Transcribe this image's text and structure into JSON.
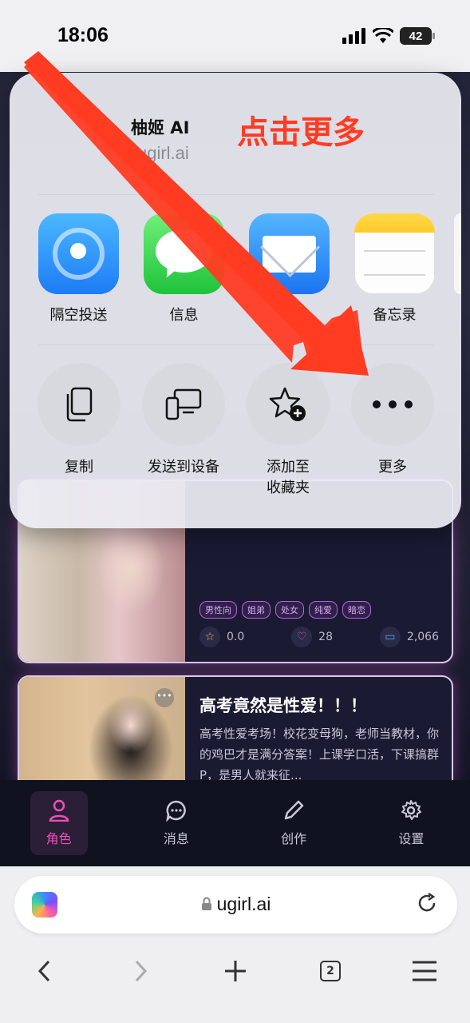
{
  "status_bar": {
    "time": "18:06",
    "battery": "42"
  },
  "share_sheet": {
    "title": "柚姬 AI",
    "url": "ugirl.ai",
    "annotation": "点击更多",
    "apps": [
      {
        "label": "隔空投送",
        "icon": "airdrop-icon"
      },
      {
        "label": "信息",
        "icon": "messages-icon"
      },
      {
        "label": "",
        "icon": "mail-icon"
      },
      {
        "label": "备忘录",
        "icon": "notes-icon"
      }
    ],
    "actions": [
      {
        "label": "复制",
        "icon": "copy-icon"
      },
      {
        "label": "发送到设备",
        "icon": "send-to-device-icon"
      },
      {
        "label": "添加至\n收藏夹",
        "icon": "add-favorite-icon"
      },
      {
        "label": "更多",
        "icon": "more-icon"
      }
    ]
  },
  "cards": [
    {
      "tags": [
        "男性向",
        "姐弟",
        "处女",
        "纯爱",
        "暗恋"
      ],
      "rating": "0.0",
      "likes": "28",
      "comments": "2,066"
    },
    {
      "title": "高考竟然是性爱！！！",
      "description": "高考性爱考场！校花变母狗，老师当教材，你的鸡巴才是满分答案！上课学口活，下课搞群P，是男人就来征..."
    }
  ],
  "tab_bar": {
    "items": [
      {
        "label": "角色",
        "icon": "person-icon",
        "active": true
      },
      {
        "label": "消息",
        "icon": "chat-icon",
        "active": false
      },
      {
        "label": "创作",
        "icon": "pencil-icon",
        "active": false
      },
      {
        "label": "设置",
        "icon": "gear-icon",
        "active": false
      }
    ],
    "accent": "#f04fb8"
  },
  "browser": {
    "url": "ugirl.ai",
    "tab_count": "2"
  },
  "colors": {
    "annotation": "#ff3b22",
    "arrow": "#ff3b22"
  }
}
